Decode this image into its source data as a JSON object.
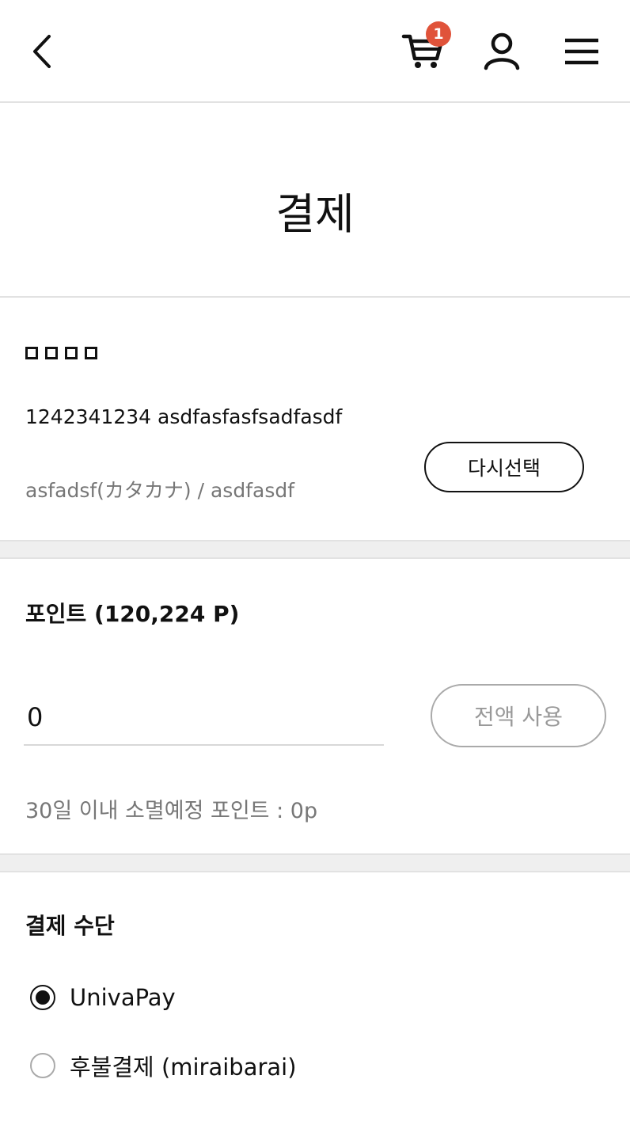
{
  "header": {
    "cart_count": "1"
  },
  "page": {
    "title": "결제"
  },
  "address": {
    "line1": "1242341234 asdfasfasfsadfasdf",
    "line2": "asfadsf(カタカナ) / asdfasdf",
    "reselect_label": "다시선택"
  },
  "points": {
    "heading": "포인트 (120,224 P)",
    "input_value": "0",
    "use_all_label": "전액 사용",
    "expiring_text": "30일 이내 소멸예정 포인트 : 0p"
  },
  "payment": {
    "heading": "결제 수단",
    "options": [
      {
        "label": "UnivaPay",
        "selected": true
      },
      {
        "label": "후불결제 (miraibarai)",
        "selected": false
      }
    ]
  }
}
